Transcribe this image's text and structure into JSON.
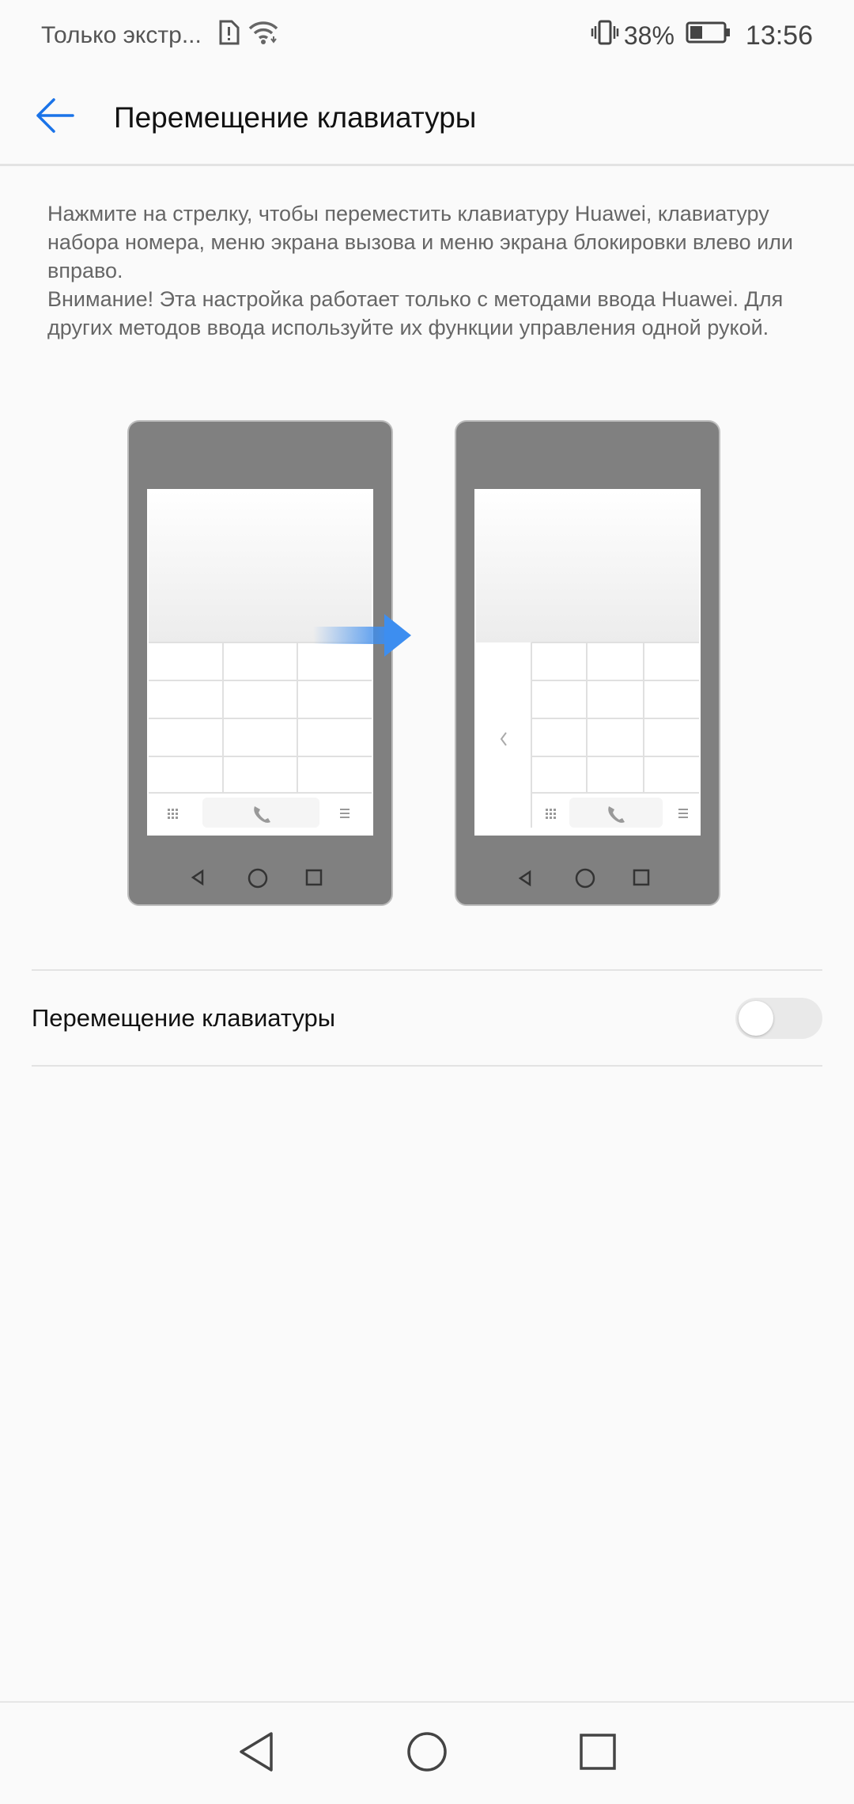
{
  "status_bar": {
    "carrier": "Только экстр...",
    "sim_icon": "sim-alert-icon",
    "wifi_icon": "wifi-icon",
    "vibrate_icon": "vibrate-icon",
    "battery_percent": "38%",
    "battery_level": 0.38,
    "time": "13:56"
  },
  "app_bar": {
    "back_icon": "arrow-left-icon",
    "title": "Перемещение клавиатуры"
  },
  "description": {
    "line1": "Нажмите на стрелку, чтобы переместить клавиатуру Huawei, клавиатуру набора номера, меню экрана вызова и меню экрана блокировки влево или вправо.",
    "line2": "Внимание! Эта настройка работает только с методами ввода Huawei. Для других методов ввода используйте их функции управления одной рукой."
  },
  "illustration": {
    "arrow_color": "#3d8ef0",
    "phone_color": "#808080"
  },
  "setting": {
    "label": "Перемещение клавиатуры",
    "enabled": false
  },
  "nav_bar": {
    "back": "back-triangle-icon",
    "home": "home-circle-icon",
    "recents": "recents-square-icon"
  }
}
